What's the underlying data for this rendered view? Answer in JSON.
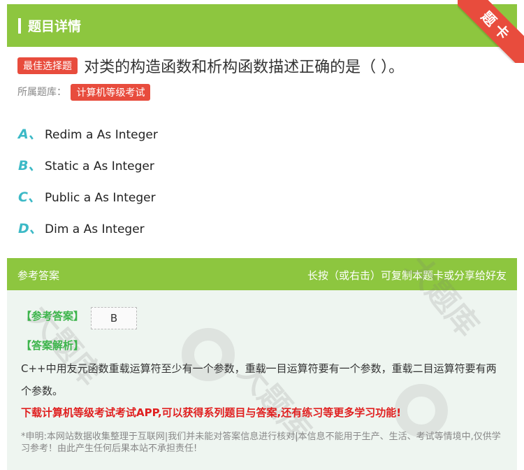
{
  "header": {
    "title": "题目详情",
    "corner_label": "题卡"
  },
  "question": {
    "badge": "最佳选择题",
    "text": "对类的构造函数和析构函数描述正确的是（    ）。",
    "library_label": "所属题库：",
    "library_name": "计算机等级考试"
  },
  "options": [
    {
      "letter": "A、",
      "text": "Redim a As Integer"
    },
    {
      "letter": "B、",
      "text": "Static a As Integer"
    },
    {
      "letter": "C、",
      "text": "Public a As Integer"
    },
    {
      "letter": "D、",
      "text": "Dim a As Integer"
    }
  ],
  "answer": {
    "section_title": "参考答案",
    "share_hint": "长按（或右击）可复制本题卡或分享给好友",
    "ref_label": "【参考答案】",
    "ref_value": "B",
    "analysis_label": "【答案解析】",
    "analysis_text": "C++中用友元函数重载运算符至少有一个参数，重载一目运算符要有一个参数，重载二目运算符要有两个参数。",
    "promo": "下载计算机等级考试考试APP,可以获得系列题目与答案,还有练习等更多学习功能!",
    "disclaimer": "*申明:本网站数据收集整理于互联网|我们并未能对答案信息进行核对|本信息不能用于生产、生活、考试等情境中,仅供学习参考！由此产生任何后果本站不承担责任!"
  },
  "colors": {
    "header_green": "#8dc63f",
    "badge_red": "#e84c3d",
    "option_letter": "#3cb9c6",
    "promo_red": "#e02020"
  }
}
